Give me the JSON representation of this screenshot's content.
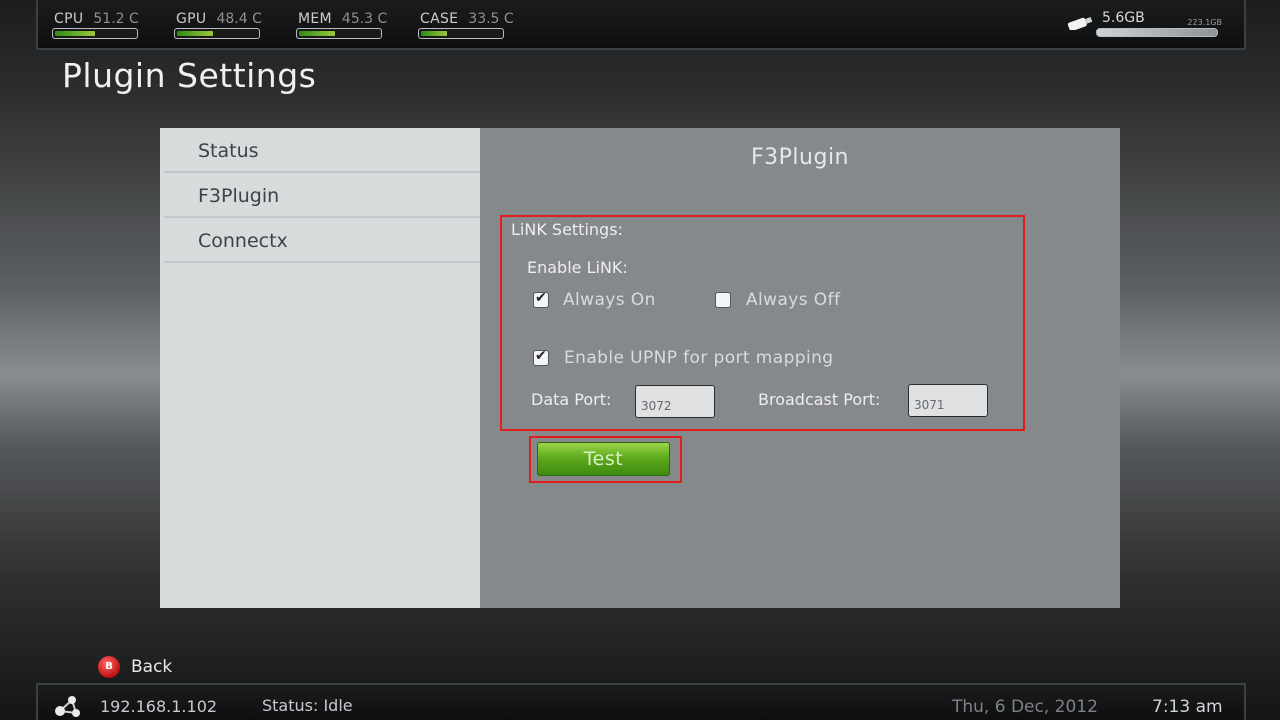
{
  "top_stats": [
    {
      "label": "CPU",
      "value": "51.2 C",
      "level": 0.5
    },
    {
      "label": "GPU",
      "value": "48.4 C",
      "level": 0.45
    },
    {
      "label": "MEM",
      "value": "45.3 C",
      "level": 0.45
    },
    {
      "label": "CASE",
      "value": "33.5 C",
      "level": 0.32
    }
  ],
  "disk": {
    "free": "5.6GB",
    "total": "223.1GB",
    "icon": "usb-drive-icon"
  },
  "page_title": "Plugin Settings",
  "menu": {
    "items": [
      {
        "label": "Status"
      },
      {
        "label": "F3Plugin"
      },
      {
        "label": "Connectx"
      }
    ]
  },
  "plugin": {
    "title": "F3Plugin",
    "link_settings_label": "LiNK Settings:",
    "enable_link_label": "Enable LiNK:",
    "always_on_label": "Always On",
    "always_on_checked": true,
    "always_off_label": "Always Off",
    "always_off_checked": false,
    "upnp_label": "Enable UPNP for port mapping",
    "upnp_checked": true,
    "data_port_label": "Data Port:",
    "data_port_value": "3072",
    "broadcast_port_label": "Broadcast Port:",
    "broadcast_port_value": "3071",
    "test_button_label": "Test"
  },
  "back": {
    "button_glyph": "B",
    "label": "Back"
  },
  "status_bar": {
    "ip": "192.168.1.102",
    "status": "Status: Idle",
    "date": "Thu, 6 Dec, 2012",
    "time": "7:13 am"
  },
  "colors": {
    "highlight_border": "#e31c1c",
    "accent_green": "#5faa1e",
    "left_panel": "#d8dbdc",
    "right_panel": "#86898b"
  }
}
